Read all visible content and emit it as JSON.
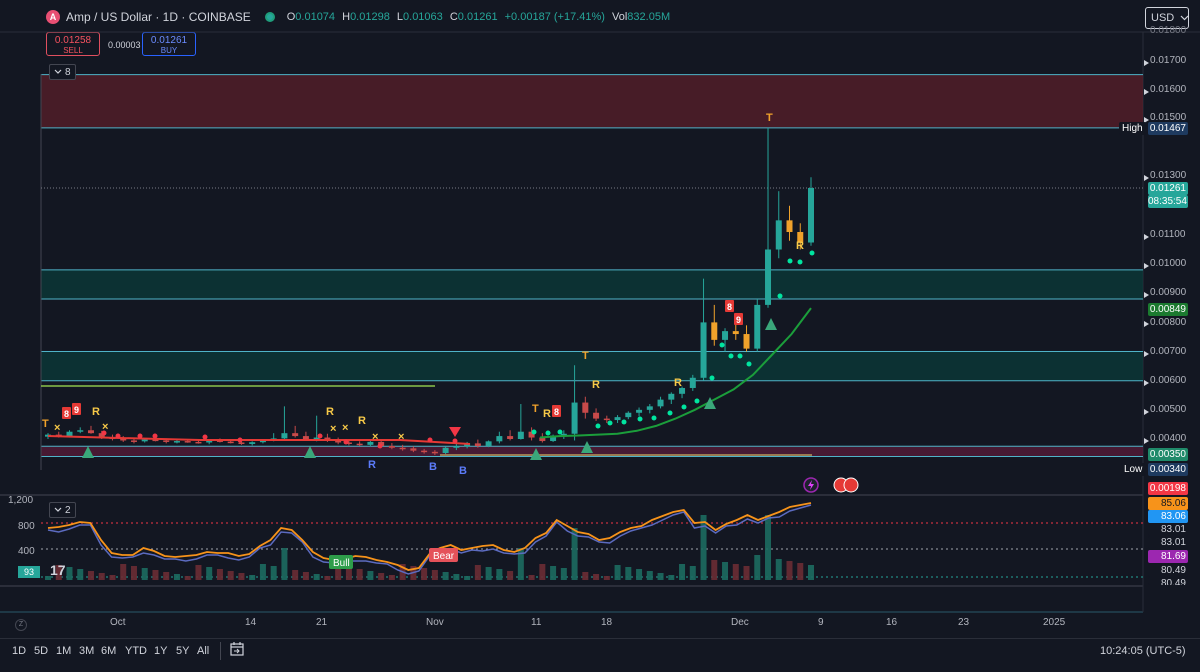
{
  "header": {
    "logo_letter": "A",
    "symbol_title": "Amp / US Dollar · 1D · COINBASE",
    "ohlc": [
      {
        "k": "O",
        "v": "0.01074"
      },
      {
        "k": "H",
        "v": "0.01298"
      },
      {
        "k": "L",
        "v": "0.01063"
      },
      {
        "k": "C",
        "v": "0.01261"
      },
      {
        "k": "",
        "v": "+0.00187 (+17.41%)"
      },
      {
        "k": "Vol",
        "v": "832.05M"
      }
    ],
    "currency": "USD"
  },
  "trade": {
    "sell_price": "0.01258",
    "sell_label": "SELL",
    "buy_price": "0.01261",
    "buy_label": "BUY",
    "spread": "0.00003"
  },
  "main_pane_tag": "8",
  "osc_pane_tag": "2",
  "price_axis": {
    "ticks": [
      "0.01700",
      "0.01600",
      "0.01500",
      "0.01400",
      "0.01300",
      "0.01200",
      "0.01100",
      "0.01000",
      "0.00900",
      "0.00800",
      "0.00700",
      "0.00600",
      "0.00500",
      "0.00400"
    ],
    "top_partial": "0.01800",
    "high_label": "High",
    "high_value": "0.01467",
    "last_price": "0.01261",
    "countdown": "08:35:54",
    "ma_value": "0.00849",
    "support_value": "0.00350",
    "low_label": "Low",
    "low_value": "0.00340",
    "red_value": "0.00198"
  },
  "osc_axis": {
    "left_ticks": [
      "1,200",
      "800",
      "400"
    ],
    "left_marker": "93",
    "right_labels": [
      "85.06",
      "83.06",
      "83.01",
      "83.01",
      "81.69",
      "80.49",
      "80.49"
    ]
  },
  "chart_markers": {
    "bull": "Bull",
    "bear": "Bear",
    "t": "T",
    "r": "R",
    "b": "B",
    "n8": "8",
    "n9": "9",
    "x": "×"
  },
  "time_axis": [
    "Oct",
    "14",
    "21",
    "Nov",
    "11",
    "18",
    "Dec",
    "9",
    "16",
    "23",
    "2025"
  ],
  "bottom_bar": {
    "ranges": [
      "1D",
      "5D",
      "1M",
      "3M",
      "6M",
      "YTD",
      "1Y",
      "5Y",
      "All"
    ],
    "clock": "10:24:05 (UTC-5)",
    "zoom_icon": "Z"
  },
  "chart_data": {
    "type": "candlestick",
    "symbol": "Amp / US Dollar",
    "interval": "1D",
    "exchange": "COINBASE",
    "last_candle": {
      "open": 0.01074,
      "high": 0.01298,
      "low": 0.01063,
      "close": 0.01261,
      "change": 0.00187,
      "change_pct": 17.41,
      "volume": "832.05M"
    },
    "price_axis_range": [
      0.0034,
      0.018
    ],
    "zones": [
      {
        "from": 0.01467,
        "to": 0.0165,
        "color": "#5a1f2a"
      },
      {
        "from": 0.0088,
        "to": 0.0098,
        "color": "#0b3b3a"
      },
      {
        "from": 0.006,
        "to": 0.007,
        "color": "#0b3b3a"
      },
      {
        "from": 0.0034,
        "to": 0.00375,
        "color": "#5a1c3a"
      }
    ],
    "levels": {
      "high": 0.01467,
      "low": 0.0034,
      "last": 0.01261,
      "ma": 0.00849,
      "support": 0.0035
    },
    "time_labels": [
      "Oct",
      "14",
      "21",
      "Nov",
      "11",
      "18",
      "Dec",
      "9",
      "16",
      "23",
      "2025"
    ],
    "candles": [
      [
        0.00408,
        0.0042,
        0.004,
        0.00415
      ],
      [
        0.00415,
        0.00425,
        0.00405,
        0.0041
      ],
      [
        0.0041,
        0.0043,
        0.00405,
        0.00425
      ],
      [
        0.00425,
        0.0044,
        0.0042,
        0.0043
      ],
      [
        0.0043,
        0.00445,
        0.00418,
        0.0042
      ],
      [
        0.0042,
        0.00428,
        0.004,
        0.00405
      ],
      [
        0.00405,
        0.00415,
        0.00395,
        0.004
      ],
      [
        0.004,
        0.0041,
        0.0039,
        0.00395
      ],
      [
        0.00395,
        0.00405,
        0.00385,
        0.00392
      ],
      [
        0.00392,
        0.004,
        0.00388,
        0.00398
      ],
      [
        0.00398,
        0.00412,
        0.00392,
        0.00395
      ],
      [
        0.00395,
        0.00402,
        0.00385,
        0.0039
      ],
      [
        0.0039,
        0.00398,
        0.00385,
        0.00393
      ],
      [
        0.00393,
        0.004,
        0.00387,
        0.0039
      ],
      [
        0.0039,
        0.00396,
        0.00384,
        0.00388
      ],
      [
        0.00388,
        0.00398,
        0.00382,
        0.00395
      ],
      [
        0.00395,
        0.00402,
        0.00388,
        0.00391
      ],
      [
        0.00391,
        0.00396,
        0.00385,
        0.00388
      ],
      [
        0.00388,
        0.00394,
        0.0038,
        0.00383
      ],
      [
        0.00383,
        0.00392,
        0.00378,
        0.00389
      ],
      [
        0.00389,
        0.004,
        0.00385,
        0.00396
      ],
      [
        0.00396,
        0.0042,
        0.00392,
        0.00402
      ],
      [
        0.00402,
        0.00512,
        0.00395,
        0.0042
      ],
      [
        0.0042,
        0.00445,
        0.00405,
        0.0041
      ],
      [
        0.0041,
        0.00425,
        0.00395,
        0.00398
      ],
      [
        0.00398,
        0.0048,
        0.00392,
        0.00405
      ],
      [
        0.00405,
        0.00418,
        0.0039,
        0.00395
      ],
      [
        0.00395,
        0.00405,
        0.00382,
        0.00388
      ],
      [
        0.00388,
        0.00396,
        0.00378,
        0.00384
      ],
      [
        0.00384,
        0.00392,
        0.00376,
        0.0038
      ],
      [
        0.0038,
        0.00395,
        0.00375,
        0.0039
      ],
      [
        0.0039,
        0.00398,
        0.00372,
        0.00376
      ],
      [
        0.00376,
        0.00386,
        0.00365,
        0.0037
      ],
      [
        0.0037,
        0.0038,
        0.0036,
        0.00368
      ],
      [
        0.00368,
        0.00375,
        0.00355,
        0.0036
      ],
      [
        0.0036,
        0.00366,
        0.0035,
        0.00356
      ],
      [
        0.00356,
        0.00362,
        0.00345,
        0.00352
      ],
      [
        0.00352,
        0.00375,
        0.00348,
        0.0037
      ],
      [
        0.0037,
        0.00385,
        0.00362,
        0.00375
      ],
      [
        0.00375,
        0.0039,
        0.00368,
        0.00385
      ],
      [
        0.00385,
        0.00398,
        0.0037,
        0.00376
      ],
      [
        0.00376,
        0.00395,
        0.00372,
        0.00392
      ],
      [
        0.00392,
        0.00425,
        0.00385,
        0.0041
      ],
      [
        0.0041,
        0.0043,
        0.00395,
        0.004
      ],
      [
        0.004,
        0.0052,
        0.00398,
        0.00425
      ],
      [
        0.00425,
        0.0044,
        0.00395,
        0.00405
      ],
      [
        0.00405,
        0.0042,
        0.00388,
        0.00393
      ],
      [
        0.00393,
        0.00415,
        0.0039,
        0.00412
      ],
      [
        0.00412,
        0.0043,
        0.004,
        0.00418
      ],
      [
        0.00418,
        0.00653,
        0.00395,
        0.00525
      ],
      [
        0.00525,
        0.00545,
        0.0047,
        0.0049
      ],
      [
        0.0049,
        0.00505,
        0.00462,
        0.0047
      ],
      [
        0.0047,
        0.0048,
        0.00455,
        0.00465
      ],
      [
        0.00465,
        0.00482,
        0.00455,
        0.00475
      ],
      [
        0.00475,
        0.00495,
        0.00468,
        0.0049
      ],
      [
        0.0049,
        0.00508,
        0.00478,
        0.005
      ],
      [
        0.005,
        0.0052,
        0.00488,
        0.00512
      ],
      [
        0.00512,
        0.00545,
        0.00505,
        0.00535
      ],
      [
        0.00535,
        0.0056,
        0.0052,
        0.00555
      ],
      [
        0.00555,
        0.0058,
        0.0054,
        0.00575
      ],
      [
        0.00575,
        0.0062,
        0.00565,
        0.0061
      ],
      [
        0.0061,
        0.0095,
        0.006,
        0.008
      ],
      [
        0.008,
        0.0086,
        0.0072,
        0.0074
      ],
      [
        0.0074,
        0.0078,
        0.007,
        0.0077
      ],
      [
        0.0077,
        0.008,
        0.0074,
        0.0076
      ],
      [
        0.0076,
        0.0079,
        0.007,
        0.0071
      ],
      [
        0.0071,
        0.0088,
        0.007,
        0.0086
      ],
      [
        0.0086,
        0.01467,
        0.0085,
        0.0105
      ],
      [
        0.0105,
        0.0125,
        0.0102,
        0.0115
      ],
      [
        0.0115,
        0.012,
        0.0108,
        0.0111
      ],
      [
        0.0111,
        0.0114,
        0.0105,
        0.01074
      ],
      [
        0.01074,
        0.01298,
        0.01063,
        0.01261
      ]
    ],
    "ma_series": [
      0.00405,
      0.0041,
      0.00412,
      0.00415,
      0.00418,
      0.00428,
      0.00445,
      0.0047,
      0.005,
      0.00535,
      0.0057,
      0.0062,
      0.0069,
      0.0076,
      0.00849
    ],
    "oscillator": {
      "left_axis_ticks": [
        1200,
        800,
        400
      ],
      "right_values": [
        85.06,
        83.06,
        83.01,
        83.01,
        81.69,
        80.49,
        80.49
      ]
    }
  }
}
